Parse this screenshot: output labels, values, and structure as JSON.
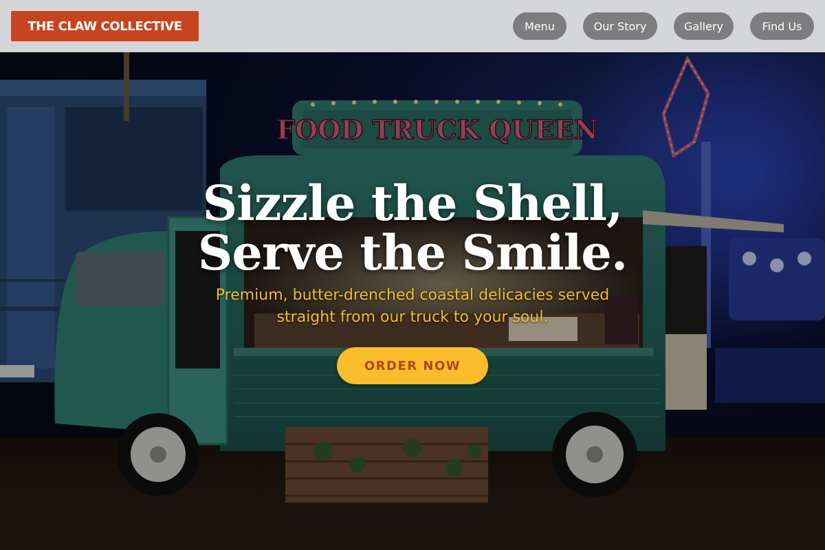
{
  "header": {
    "logo": "THE CLAW COLLECTIVE",
    "nav": [
      {
        "label": "Menu"
      },
      {
        "label": "Our Story"
      },
      {
        "label": "Gallery"
      },
      {
        "label": "Find Us"
      }
    ]
  },
  "hero": {
    "headline_line1": "Sizzle the Shell,",
    "headline_line2": "Serve the Smile.",
    "subtitle_line1": "Premium, butter-drenched coastal delicacies served",
    "subtitle_line2": "straight from our truck to your soul.",
    "cta_label": "ORDER NOW",
    "truck_sign": "FOOD TRUCK QUEEN"
  },
  "colors": {
    "brand": "#c8441f",
    "accent": "#fbbd2c",
    "subtitle": "#f1bd2c",
    "nav_pill": "#7d7d7f",
    "header_bg": "#d5d6d8"
  }
}
